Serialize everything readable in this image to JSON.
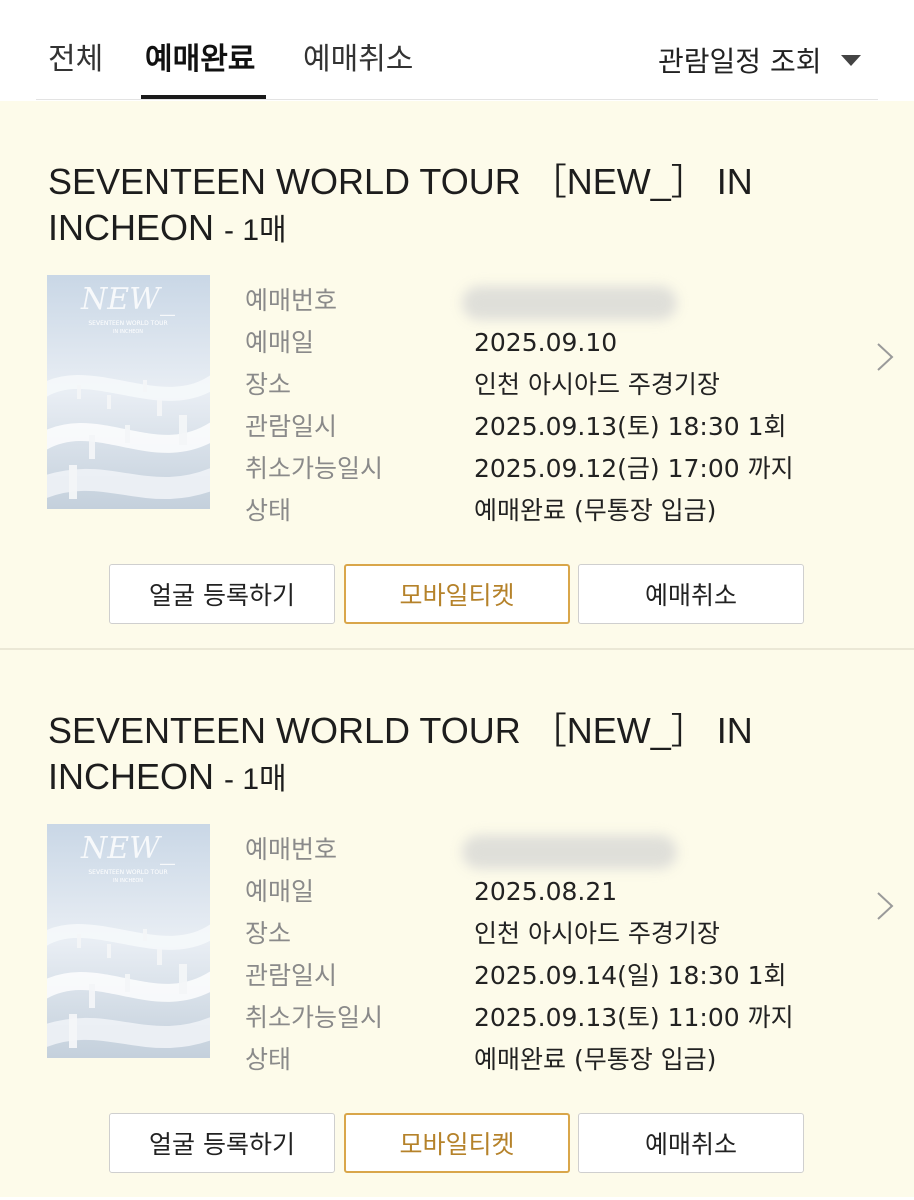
{
  "tabs": [
    {
      "label": "전체"
    },
    {
      "label": "예매완료",
      "active": true
    },
    {
      "label": "예매취소"
    }
  ],
  "filter": {
    "label": "관람일정 조회",
    "icon": "caret-down-icon"
  },
  "colors": {
    "card_bg": "#fdfbea",
    "accent": "#d9a64a",
    "active_tab": "#1a1a1a"
  },
  "bookings": [
    {
      "title": "SEVENTEEN WORLD TOUR ［NEW_］ IN INCHEON",
      "quantity": "- 1매",
      "poster_text": {
        "logo": "NEW_",
        "line1": "SEVENTEEN WORLD TOUR",
        "line2": "IN INCHEON"
      },
      "labels": {
        "booking_no": "예매번호",
        "booking_date": "예매일",
        "venue": "장소",
        "show_time": "관람일시",
        "cancel_deadline": "취소가능일시",
        "status": "상태"
      },
      "booking_date": "2025.09.10",
      "venue": "인천 아시아드 주경기장",
      "show_time": "2025.09.13(토) 18:30 1회",
      "cancel_deadline": "2025.09.12(금) 17:00 까지",
      "status": "예매완료 (무통장 입금)",
      "buttons": {
        "face": "얼굴 등록하기",
        "mobile": "모바일티켓",
        "cancel": "예매취소"
      }
    },
    {
      "title": "SEVENTEEN WORLD TOUR ［NEW_］ IN INCHEON",
      "quantity": "- 1매",
      "poster_text": {
        "logo": "NEW_",
        "line1": "SEVENTEEN WORLD TOUR",
        "line2": "IN INCHEON"
      },
      "labels": {
        "booking_no": "예매번호",
        "booking_date": "예매일",
        "venue": "장소",
        "show_time": "관람일시",
        "cancel_deadline": "취소가능일시",
        "status": "상태"
      },
      "booking_date": "2025.08.21",
      "venue": "인천 아시아드 주경기장",
      "show_time": "2025.09.14(일) 18:30 1회",
      "cancel_deadline": "2025.09.13(토) 11:00 까지",
      "status": "예매완료 (무통장 입금)",
      "buttons": {
        "face": "얼굴 등록하기",
        "mobile": "모바일티켓",
        "cancel": "예매취소"
      }
    }
  ]
}
